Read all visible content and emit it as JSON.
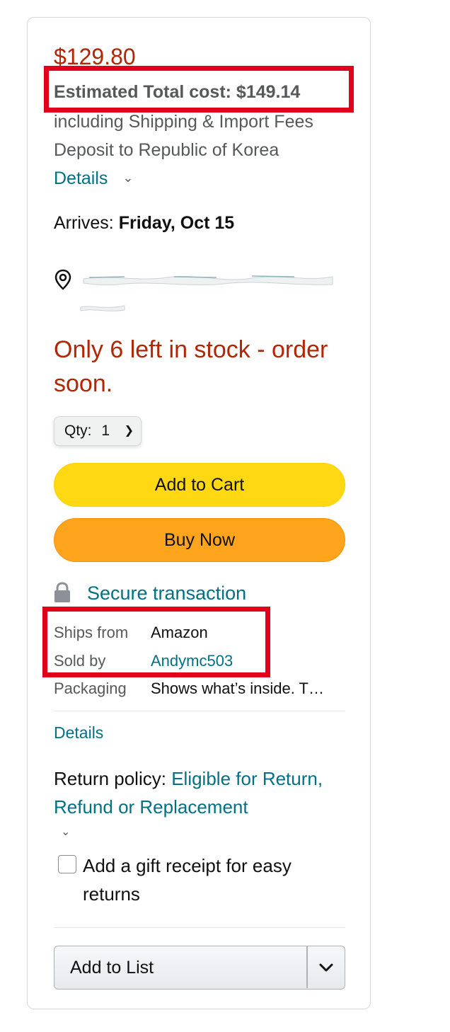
{
  "price": "$129.80",
  "estimated_total": "Estimated Total cost: $149.14",
  "shipping": {
    "text": "including Shipping & Import Fees Deposit to Republic of Korea",
    "details_link": "Details"
  },
  "arrives": {
    "label": "Arrives:",
    "date": "Friday, Oct 15"
  },
  "location": {
    "icon": "map-pin-icon",
    "redacted": true
  },
  "stock_message": "Only 6 left in stock - order soon.",
  "quantity": {
    "label": "Qty:",
    "value": "1"
  },
  "buttons": {
    "add_to_cart": "Add to Cart",
    "buy_now": "Buy Now",
    "add_to_list": "Add to List"
  },
  "secure_transaction": "Secure transaction",
  "info_rows": [
    {
      "label": "Ships from",
      "value": "Amazon"
    },
    {
      "label": "Sold by",
      "value": "Andymc503"
    },
    {
      "label": "Packaging",
      "value": "Shows what’s inside. T…"
    }
  ],
  "details_link": "Details",
  "return_policy": {
    "label": "Return policy:",
    "link": "Eligible for Return, Refund or Replacement"
  },
  "gift_receipt": {
    "label": "Add a gift receipt for easy returns",
    "checked": false
  },
  "colors": {
    "price_red": "#B12704",
    "link_teal": "#007185",
    "cart_yellow": "#FFD814",
    "buy_orange": "#FFA41C",
    "highlight_red": "#E0001B"
  }
}
